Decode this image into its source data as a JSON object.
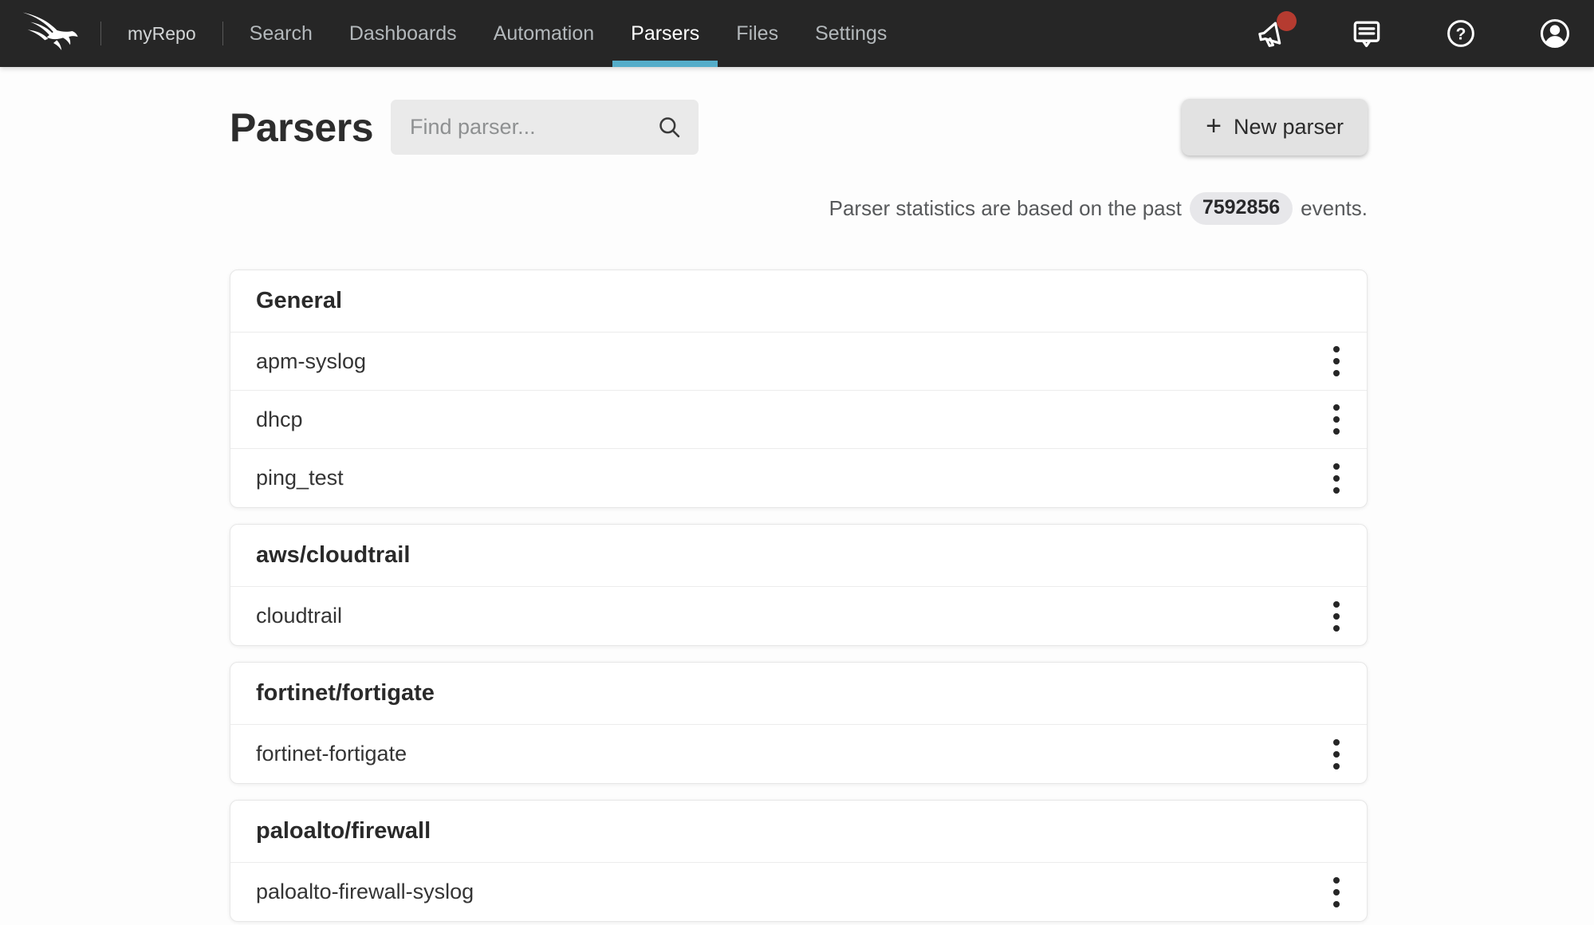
{
  "nav": {
    "repo": "myRepo",
    "items": [
      {
        "label": "Search",
        "active": false
      },
      {
        "label": "Dashboards",
        "active": false
      },
      {
        "label": "Automation",
        "active": false
      },
      {
        "label": "Parsers",
        "active": true
      },
      {
        "label": "Files",
        "active": false
      },
      {
        "label": "Settings",
        "active": false
      }
    ],
    "icons": {
      "logo": "crowdstrike-falcon-logo",
      "announcements": "megaphone-icon",
      "feedback": "chat-bubble-icon",
      "help": "question-circle-icon",
      "account": "avatar-icon"
    },
    "has_notification": true
  },
  "header": {
    "title": "Parsers",
    "search_placeholder": "Find parser...",
    "new_parser": {
      "plus_glyph": "+",
      "label": "New parser"
    }
  },
  "stats": {
    "text_before": "Parser statistics are based on the past",
    "events_count": "7592856",
    "text_after": "events."
  },
  "groups": [
    {
      "name": "General",
      "parsers": [
        "apm-syslog",
        "dhcp",
        "ping_test"
      ]
    },
    {
      "name": "aws/cloudtrail",
      "parsers": [
        "cloudtrail"
      ]
    },
    {
      "name": "fortinet/fortigate",
      "parsers": [
        "fortinet-fortigate"
      ]
    },
    {
      "name": "paloalto/firewall",
      "parsers": [
        "paloalto-firewall-syslog"
      ]
    }
  ],
  "colors": {
    "navbar_bg": "#262626",
    "active_tab_underline": "#55adc9",
    "notification_red": "#b53b30",
    "card_bg": "#ffffff",
    "search_bg": "#eaeaea",
    "button_bg": "#e2e2e2"
  }
}
